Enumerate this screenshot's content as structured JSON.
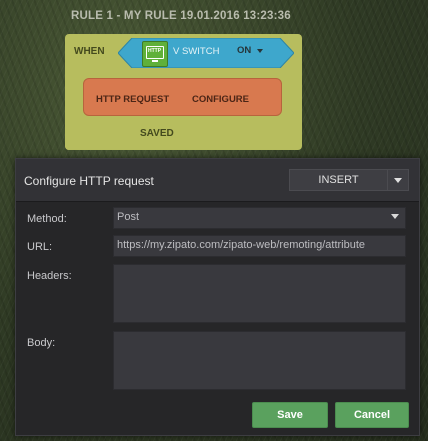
{
  "rule": {
    "title": "RULE 1 - MY RULE 19.01.2016 13:23:36",
    "when_label": "WHEN",
    "device_label": "V SWITCH",
    "device_icon_text": "HTTP",
    "state_label": "ON",
    "action_label": "HTTP REQUEST",
    "configure_label": "CONFIGURE",
    "saved_label": "SAVED",
    "colors": {
      "rule_block": "#b7bd5e",
      "device_block": "#3ea7cc",
      "action_block": "#d8794f"
    }
  },
  "dialog": {
    "title": "Configure HTTP request",
    "insert_label": "INSERT",
    "fields": {
      "method_label": "Method:",
      "method_value": "Post",
      "url_label": "URL:",
      "url_value": "https://my.zipato.com/zipato-web/remoting/attribute",
      "headers_label": "Headers:",
      "headers_value": "",
      "body_label": "Body:",
      "body_value": ""
    },
    "save_label": "Save",
    "cancel_label": "Cancel"
  }
}
